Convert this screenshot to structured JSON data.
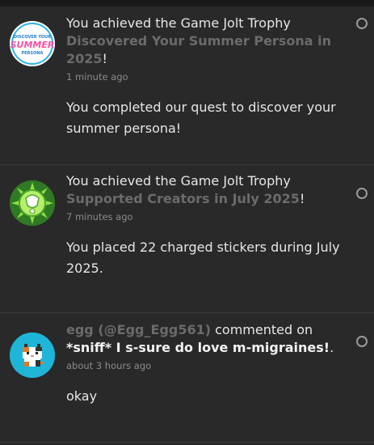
{
  "notifications": [
    {
      "prefix": "You achieved the Game Jolt Trophy",
      "trophy": "Discovered Your Summer Persona in 2025",
      "suffix": "!",
      "time": "1 minute ago",
      "body": "You completed our quest to discover your summer persona!",
      "avatar_icon": "summer-persona-trophy-icon",
      "avatar_text_top": "DISCOVER YOUR",
      "avatar_text_main": "SUMMER",
      "avatar_text_bottom": "PERSONA"
    },
    {
      "prefix": "You achieved the Game Jolt Trophy",
      "trophy": "Supported Creators in July 2025",
      "suffix": "!",
      "time": "7 minutes ago",
      "body": "You placed 22 charged stickers during July 2025.",
      "avatar_icon": "supported-creators-trophy-icon"
    },
    {
      "user": "egg (@Egg_Egg561)",
      "action": "commented on",
      "post": "*sniff* I s-sure do love m-migraines!",
      "suffix": ".",
      "time": "about 3 hours ago",
      "body": "okay",
      "avatar_icon": "cat-avatar-icon"
    }
  ],
  "colors": {
    "background": "#292929",
    "link_muted": "#6b6b6b",
    "avatar_summer_bg": "#ffffff",
    "avatar_trophy_green": "#7fd63a",
    "avatar_cat_bg": "#1fb5d6"
  }
}
